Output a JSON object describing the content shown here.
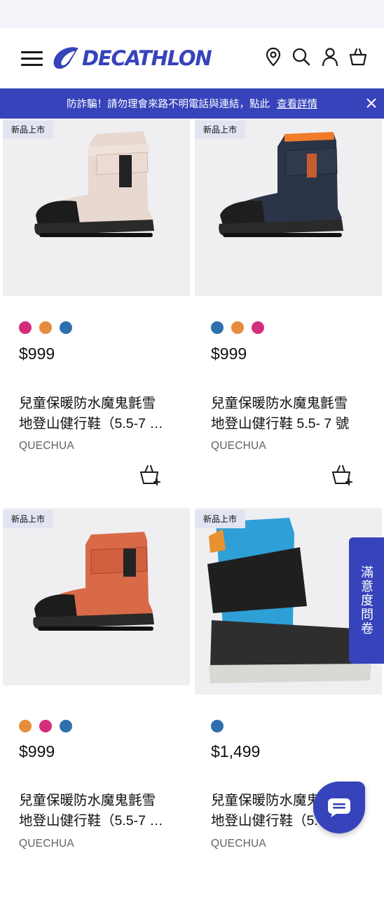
{
  "header": {
    "logo_text": "DECATHLON",
    "icons": [
      "menu-icon",
      "store-locator-icon",
      "search-icon",
      "account-icon",
      "cart-icon"
    ]
  },
  "banner": {
    "text": "防詐騙！請勿理會來路不明電話與連結，點此",
    "link_text": "查看詳情"
  },
  "colors": {
    "brand": "#3643ba",
    "badge_bg": "#e2e4f2",
    "swatch_pink": "#d42d7b",
    "swatch_orange": "#e68c3a",
    "swatch_blue": "#2f6fad"
  },
  "products": [
    {
      "badge": "新品上市",
      "swatches": [
        "#d42d7b",
        "#e68c3a",
        "#2f6fad"
      ],
      "price": "$999",
      "title_line1": "兒童保暖防水魔鬼氈雪",
      "title_line2": "地登山健行鞋（5.5-7 …",
      "brand": "QUECHUA"
    },
    {
      "badge": "新品上市",
      "swatches": [
        "#2f6fad",
        "#e68c3a",
        "#d42d7b"
      ],
      "price": "$999",
      "title_line1": "兒童保暖防水魔鬼氈雪",
      "title_line2": "地登山健行鞋 5.5- 7 號",
      "brand": "QUECHUA"
    },
    {
      "badge": "新品上市",
      "swatches": [
        "#e68c3a",
        "#d42d7b",
        "#2f6fad"
      ],
      "price": "$999",
      "title_line1": "兒童保暖防水魔鬼氈雪",
      "title_line2": "地登山健行鞋（5.5-7 …",
      "brand": "QUECHUA"
    },
    {
      "badge": "新品上市",
      "swatches": [
        "#2f6fad"
      ],
      "price": "$1,499",
      "title_line1": "兒童保暖防水魔鬼",
      "title_line2": "地登山健行鞋（5.",
      "brand": "QUECHUA"
    }
  ],
  "survey_tab": {
    "label": "滿意度問卷"
  }
}
